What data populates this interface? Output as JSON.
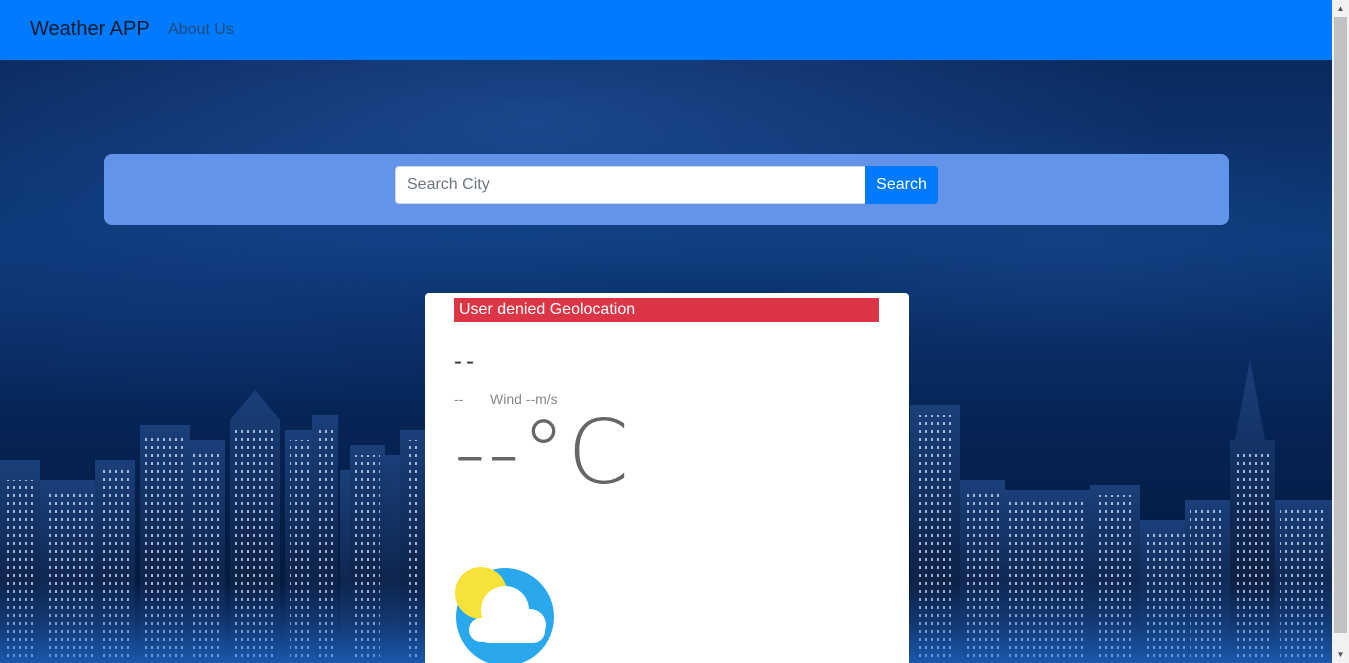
{
  "navbar": {
    "brand": "Weather APP",
    "links": [
      {
        "label": "About Us"
      }
    ],
    "color": "#007bff"
  },
  "search": {
    "placeholder": "Search City",
    "value": "",
    "button_label": "Search",
    "panel_color": "#6494ea"
  },
  "weather": {
    "alert": "User denied Geolocation",
    "alert_color": "#dc3545",
    "city": "--",
    "description": "--",
    "wind": "Wind --m/s",
    "temperature": "--°C",
    "icon": "partly-cloudy-icon"
  },
  "scrollbar": {
    "up_icon": "scroll-up-arrow-icon",
    "down_icon": "scroll-down-arrow-icon"
  }
}
